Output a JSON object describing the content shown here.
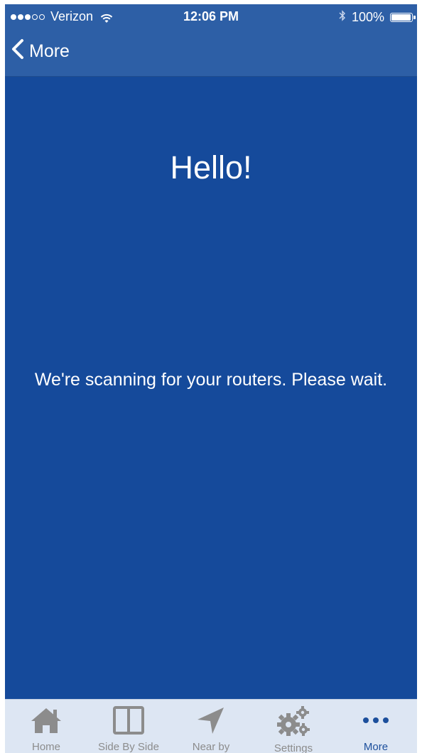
{
  "status_bar": {
    "carrier": "Verizon",
    "time": "12:06 PM",
    "battery": "100%",
    "signal_bars_filled": 3,
    "signal_bars_total": 5,
    "battery_level": 1.0
  },
  "nav": {
    "back_label": "More"
  },
  "main": {
    "greeting": "Hello!",
    "message": "We're scanning for your routers. Please wait."
  },
  "tabs": [
    {
      "label": "Home",
      "icon": "home-icon",
      "active": false
    },
    {
      "label": "Side By Side",
      "icon": "side-by-side-icon",
      "active": false
    },
    {
      "label": "Near by",
      "icon": "location-arrow-icon",
      "active": false
    },
    {
      "label": "Settings",
      "icon": "gears-icon",
      "active": false
    },
    {
      "label": "More",
      "icon": "more-dots-icon",
      "active": true
    }
  ],
  "colors": {
    "background": "#154a9b",
    "header": "#2d5fa6",
    "tab_bar": "#dde6f3",
    "tab_inactive": "#8c8c8c",
    "tab_active": "#1c4f9c"
  }
}
